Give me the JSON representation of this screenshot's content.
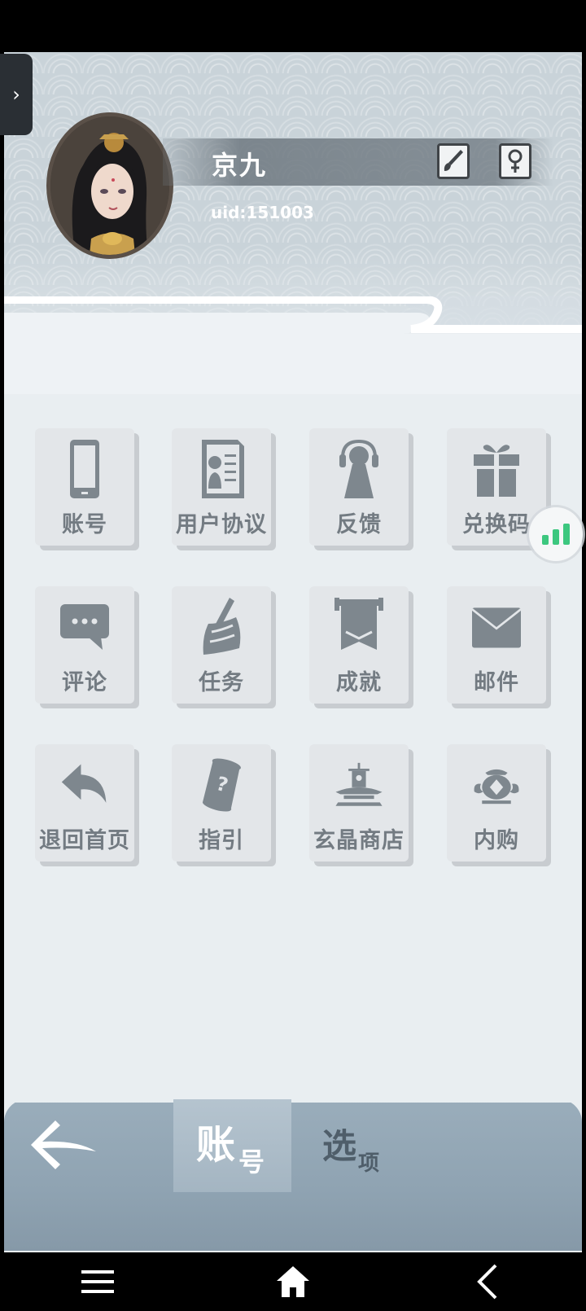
{
  "profile": {
    "name": "京九",
    "uid": "uid:151003"
  },
  "expand_tab": {
    "glyph": "›"
  },
  "header_buttons": {
    "edit_icon": "brush-icon",
    "gender_icon": "female-symbol-icon"
  },
  "menu": {
    "rows": [
      [
        {
          "label": "账号",
          "icon": "phone-icon"
        },
        {
          "label": "用户协议",
          "icon": "document-icon"
        },
        {
          "label": "反馈",
          "icon": "headset-icon"
        },
        {
          "label": "兑换码",
          "icon": "gift-icon"
        }
      ],
      [
        {
          "label": "评论",
          "icon": "chat-bubble-icon"
        },
        {
          "label": "任务",
          "icon": "scroll-brush-icon"
        },
        {
          "label": "成就",
          "icon": "banner-icon"
        },
        {
          "label": "邮件",
          "icon": "envelope-icon"
        }
      ],
      [
        {
          "label": "退回首页",
          "icon": "return-arrow-icon"
        },
        {
          "label": "指引",
          "icon": "question-scroll-icon"
        },
        {
          "label": "玄晶商店",
          "icon": "pavilion-icon"
        },
        {
          "label": "内购",
          "icon": "ornament-coin-icon"
        }
      ]
    ]
  },
  "bottom_tabs": {
    "account": {
      "char1": "账",
      "char2": "号",
      "selected": true
    },
    "options": {
      "char1": "选",
      "char2": "项",
      "selected": false
    }
  },
  "colors": {
    "accent_green": "#3cc77f",
    "tile_label": "#737b82",
    "bottom_bar": "#8fa3b2"
  }
}
